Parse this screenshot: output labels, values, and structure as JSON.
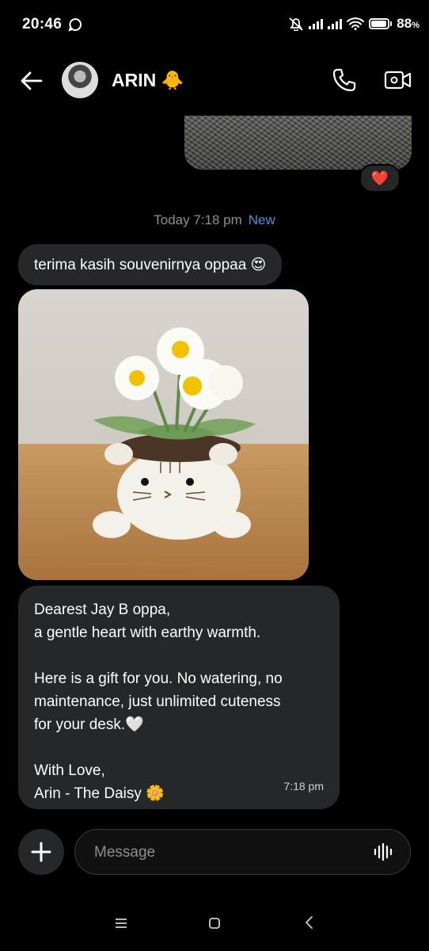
{
  "status_bar": {
    "time": "20:46",
    "battery": "88",
    "battery_unit": "%"
  },
  "header": {
    "contact_name": "ARIN 🐥"
  },
  "thread": {
    "reaction": "❤️",
    "timestamp": "Today 7:18 pm",
    "new_label": "New",
    "message1": "terima kasih souvenirnya oppaa 😍",
    "message2": {
      "line1": "Dearest Jay B oppa,",
      "line2": "a gentle heart with earthy warmth.",
      "line3": "Here is a gift for you. No watering, no",
      "line4": "maintenance, just unlimited cuteness",
      "line5": "for your desk.🤍",
      "line6": "With Love,",
      "line7": "Arin - The Daisy 🌼",
      "time": "7:18 pm"
    }
  },
  "composer": {
    "placeholder": "Message"
  },
  "icons": {
    "back": "arrow-left-icon",
    "call": "phone-icon",
    "video": "video-camera-icon",
    "add": "plus-icon",
    "voice": "waveform-icon"
  }
}
